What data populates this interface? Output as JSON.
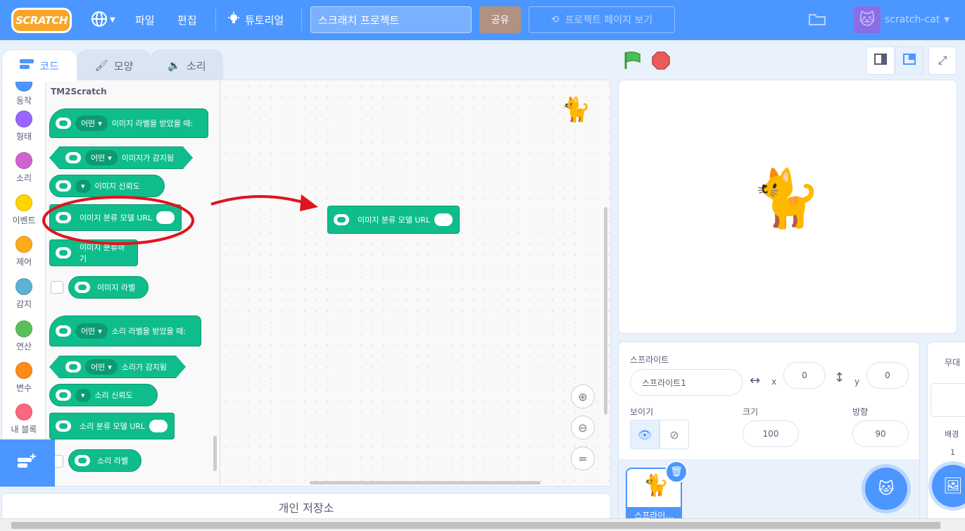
{
  "menubar": {
    "logo": "SCRATCH",
    "file": "파일",
    "edit": "편집",
    "tutorials": "튜토리얼",
    "project_title": "스크래치 프로젝트",
    "share": "공유",
    "see_project_page": "프로젝트 페이지 보기",
    "username": "scratch-cat"
  },
  "tabs": {
    "code": "코드",
    "costumes": "모양",
    "sounds": "소리"
  },
  "categories": [
    {
      "label": "동작",
      "color": "#4c97ff"
    },
    {
      "label": "형태",
      "color": "#9966ff"
    },
    {
      "label": "소리",
      "color": "#cf63cf"
    },
    {
      "label": "이벤트",
      "color": "#ffd500"
    },
    {
      "label": "제어",
      "color": "#ffab19"
    },
    {
      "label": "감지",
      "color": "#5cb1d6"
    },
    {
      "label": "연산",
      "color": "#59c059"
    },
    {
      "label": "변수",
      "color": "#ff8c1a"
    },
    {
      "label": "내 블록",
      "color": "#ff6680"
    }
  ],
  "palette": {
    "section_title": "TM2Scratch",
    "blocks": {
      "when_image_label": "이미지 라벨을 받았을 때:",
      "image_detected": "이미지가 감지됨",
      "image_confidence": "이미지 신뢰도",
      "image_model_url": "이미지 분류 모델 URL",
      "classify_image": "이미지 분류하기",
      "image_label": "이미지 라벨",
      "when_sound_label": "소리 라벨을 받았을 때:",
      "sound_detected": "소리가 감지됨",
      "sound_confidence": "소리 신뢰도",
      "sound_model_url": "소리 분류 모델 URL",
      "sound_label": "소리 라벨",
      "dropdown_any": "어떤"
    }
  },
  "workspace": {
    "block_label": "이미지 분류 모델 URL"
  },
  "backpack": "개인 저장소",
  "sprite_info": {
    "sprite_label": "스프라이트",
    "sprite_name": "스프라이트1",
    "x_label": "x",
    "x_value": "0",
    "y_label": "y",
    "y_value": "0",
    "show_label": "보이기",
    "size_label": "크기",
    "size_value": "100",
    "direction_label": "방향",
    "direction_value": "90",
    "thumb_caption": "스프라이..."
  },
  "backdrop_pane": {
    "stage_label": "무대",
    "backdrops_label": "배경",
    "backdrop_count": "1"
  },
  "colors": {
    "menubar": "#4c97ff",
    "extension_block": "#0fbd8c",
    "annotation": "#e0141e"
  }
}
